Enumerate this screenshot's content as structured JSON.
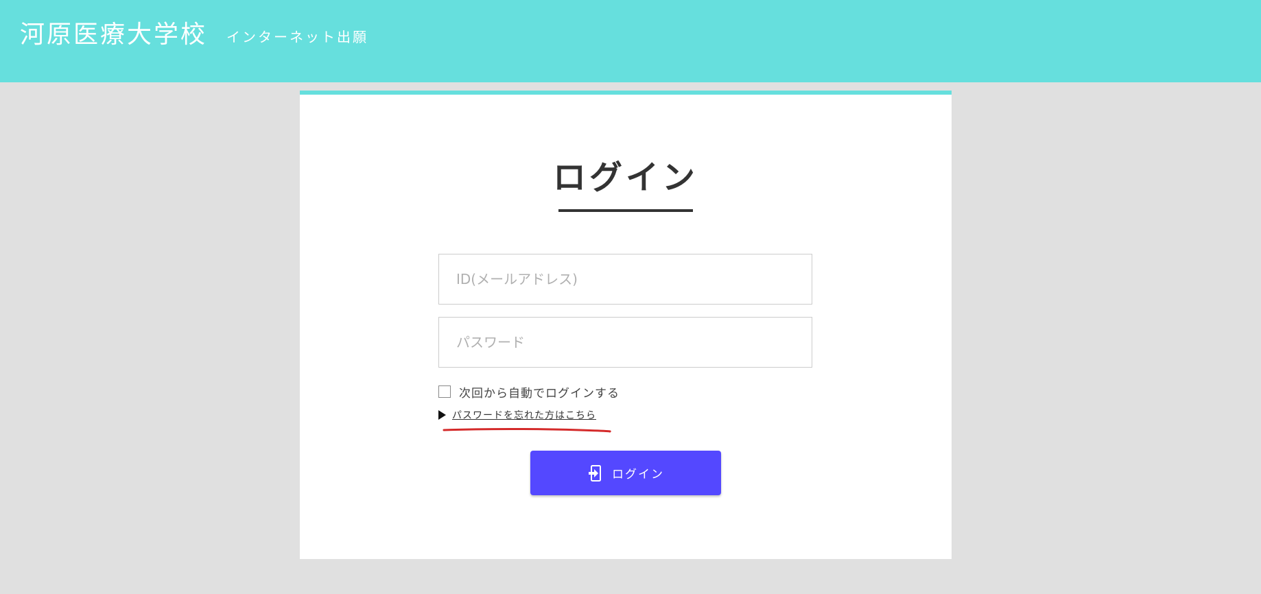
{
  "header": {
    "school_name": "河原医療大学校",
    "subtitle": "インターネット出願",
    "color": "#66dfdd"
  },
  "login": {
    "title": "ログイン",
    "id_placeholder": "ID(メールアドレス)",
    "id_value": "",
    "password_placeholder": "パスワード",
    "password_value": "",
    "remember_label": "次回から自動でログインする",
    "remember_checked": false,
    "forgot_link": "パスワードを忘れた方はこちら",
    "button_label": "ログイン",
    "button_icon": "login-icon",
    "button_color": "#5448ff"
  }
}
